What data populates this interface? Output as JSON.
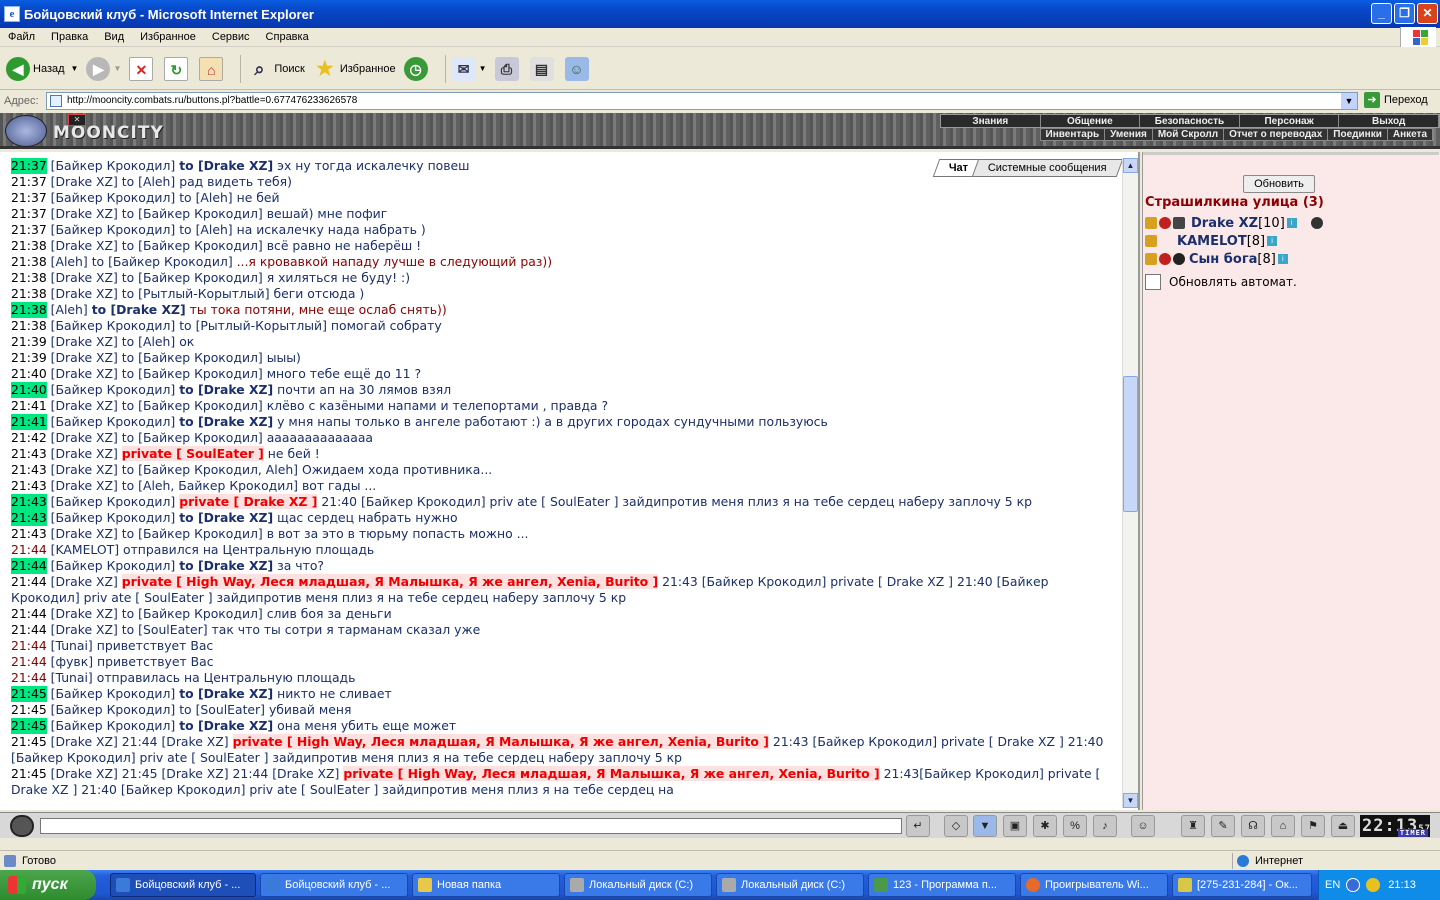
{
  "window": {
    "title": "Бойцовский клуб - Microsoft Internet Explorer"
  },
  "menu": [
    "Файл",
    "Правка",
    "Вид",
    "Избранное",
    "Сервис",
    "Справка"
  ],
  "toolbar": {
    "back": "Назад",
    "search": "Поиск",
    "favorites": "Избранное"
  },
  "address": {
    "label": "Адрес:",
    "url": "http://mooncity.combats.ru/buttons.pl?battle=0.677476233626578",
    "go": "Переход"
  },
  "game": {
    "logo": "MOONCITY",
    "nav": [
      "Знания",
      "Общение",
      "Безопасность",
      "Персонаж",
      "Выход"
    ],
    "subnav": [
      "Инвентарь",
      "Умения",
      "Мой Скролл",
      "Отчет о переводах",
      "Поединки",
      "Анкета"
    ]
  },
  "chat": {
    "tabs": [
      "Чат",
      "Системные сообщения"
    ],
    "messages": [
      {
        "time": "21:37",
        "hl": true,
        "nick": "[Байкер Крокодил]",
        "to": "to [Drake XZ]",
        "tobold": true,
        "text": "эх ну тогда искалечку повеш"
      },
      {
        "time": "21:37",
        "nick": "[Drake XZ]",
        "to": "to [Aleh]",
        "text": "рад видеть тебя)"
      },
      {
        "time": "21:37",
        "nick": "[Байкер Крокодил]",
        "to": "to [Aleh]",
        "text": "не бей"
      },
      {
        "time": "21:37",
        "nick": "[Drake XZ]",
        "to": "to [Байкер Крокодил]",
        "text": "вешай) мне пофиг"
      },
      {
        "time": "21:37",
        "nick": "[Байкер Крокодил]",
        "to": "to [Aleh]",
        "text": "на искалечку нада набрать )"
      },
      {
        "time": "21:38",
        "nick": "[Drake XZ]",
        "to": "to [Байкер Крокодил]",
        "text": "всё равно не наберёш !"
      },
      {
        "time": "21:38",
        "nick": "[Aleh]",
        "to": "to [Байкер Крокодил]",
        "text": "...я кровавкой нападу лучше в следующий раз))",
        "red": true
      },
      {
        "time": "21:38",
        "nick": "[Drake XZ]",
        "to": "to [Байкер Крокодил]",
        "text": "я хиляться не буду! :)"
      },
      {
        "time": "21:38",
        "nick": "[Drake XZ]",
        "to": "to [Рытлый-Корытлый]",
        "text": "беги отсюда )"
      },
      {
        "time": "21:38",
        "hl": true,
        "nick": "[Aleh]",
        "to": "to [Drake XZ]",
        "tobold": true,
        "text": "ты тока потяни, мне еще ослаб снять))",
        "red": true
      },
      {
        "time": "21:38",
        "nick": "[Байкер Крокодил]",
        "to": "to [Рытлый-Корытлый]",
        "text": "помогай собрату"
      },
      {
        "time": "21:39",
        "nick": "[Drake XZ]",
        "to": "to [Aleh]",
        "text": "ок"
      },
      {
        "time": "21:39",
        "nick": "[Drake XZ]",
        "to": "to [Байкер Крокодил]",
        "text": "ыыы)"
      },
      {
        "time": "21:40",
        "nick": "[Drake XZ]",
        "to": "to [Байкер Крокодил]",
        "text": "много тебе ещё до 11 ?"
      },
      {
        "time": "21:40",
        "hl": true,
        "nick": "[Байкер Крокодил]",
        "to": "to [Drake XZ]",
        "tobold": true,
        "text": "почти ап на 30 лямов взял"
      },
      {
        "time": "21:41",
        "nick": "[Drake XZ]",
        "to": "to [Байкер Крокодил]",
        "text": "клёво с казёными напами и телепортами , правда ?"
      },
      {
        "time": "21:41",
        "hl": true,
        "nick": "[Байкер Крокодил]",
        "to": "to [Drake XZ]",
        "tobold": true,
        "text": "у мня напы только в ангеле работают :) а в других городах сундучными пользуюсь"
      },
      {
        "time": "21:42",
        "nick": "[Drake XZ]",
        "to": "to [Байкер Крокодил]",
        "text": "аааааааааааааа"
      },
      {
        "time": "21:43",
        "nick": "[Drake XZ]",
        "priv": "private [ SoulEater ]",
        "text": "не бей !"
      },
      {
        "time": "21:43",
        "nick": "[Drake XZ]",
        "to": "to [Байкер Крокодил, Aleh]",
        "text": "Ожидаем хода противника..."
      },
      {
        "time": "21:43",
        "nick": "[Drake XZ]",
        "to": "to [Aleh, Байкер Крокодил]",
        "text": "вот гады ..."
      },
      {
        "time": "21:43",
        "hl": true,
        "nick": "[Байкер Крокодил]",
        "priv": "private [ Drake XZ ]",
        "text": "21:40 [Байкер Крокодил] priv ate [ SoulEater ] зайдипротив меня плиз я на тебе сердец наберу заплочу 5 кр"
      },
      {
        "time": "21:43",
        "hl": true,
        "nick": "[Байкер Крокодил]",
        "to": "to [Drake XZ]",
        "tobold": true,
        "text": "щас сердец набрать нужно"
      },
      {
        "time": "21:43",
        "nick": "[Drake XZ]",
        "to": "to [Байкер Крокодил]",
        "text": "в вот за это в тюрьму попасть можно ..."
      },
      {
        "time": "21:44",
        "sys": true,
        "nick": "[KAMELOT]",
        "text": "отправился на Центральную площадь"
      },
      {
        "time": "21:44",
        "hl": true,
        "nick": "[Байкер Крокодил]",
        "to": "to [Drake XZ]",
        "tobold": true,
        "text": "за что?"
      },
      {
        "time": "21:44",
        "nick": "[Drake XZ]",
        "priv": "private [ High Way, Леся младшая, Я Малышка, Я же ангел, Xenia, Burito ]",
        "text": "21:43 [Байкер Крокодил] private [ Drake XZ ] 21:40 [Байкер Крокодил] priv ate [ SoulEater ] зайдипротив меня плиз я на тебе сердец наберу заплочу 5 кр",
        "tall": true
      },
      {
        "time": "21:44",
        "nick": "[Drake XZ]",
        "to": "to [Байкер Крокодил]",
        "text": "слив боя за деньги"
      },
      {
        "time": "21:44",
        "nick": "[Drake XZ]",
        "to": "to [SoulEater]",
        "text": "так что ты сотри я тарманам сказал уже"
      },
      {
        "time": "21:44",
        "sys": true,
        "nick": "[Tunai]",
        "text": "приветствует Вас"
      },
      {
        "time": "21:44",
        "sys": true,
        "nick": "[фувк]",
        "text": "приветствует Вас"
      },
      {
        "time": "21:44",
        "sys": true,
        "nick": "[Tunai]",
        "text": "отправилась на Центральную площадь"
      },
      {
        "time": "21:45",
        "hl": true,
        "nick": "[Байкер Крокодил]",
        "to": "to [Drake XZ]",
        "tobold": true,
        "text": "никто не сливает"
      },
      {
        "time": "21:45",
        "nick": "[Байкер Крокодил]",
        "to": "to [SoulEater]",
        "text": "убивай меня"
      },
      {
        "time": "21:45",
        "hl": true,
        "nick": "[Байкер Крокодил]",
        "to": "to [Drake XZ]",
        "tobold": true,
        "text": "она меня убить еще может"
      },
      {
        "time": "21:45",
        "nick": "[Drake XZ]",
        "pre": "21:44 [Drake XZ]",
        "priv": "private [ High Way, Леся младшая, Я Малышка, Я же ангел, Xenia, Burito ]",
        "text": "21:43 [Байкер Крокодил] private [ Drake XZ ] 21:40 [Байкер Крокодил] priv ate [ SoulEater ] зайдипротив меня плиз я на тебе сердец наберу заплочу 5 кр",
        "tall": true
      },
      {
        "time": "21:45",
        "nick": "[Drake XZ]",
        "pre": "21:45 [Drake XZ] 21:44 [Drake XZ]",
        "priv": "private [ High Way, Леся младшая, Я Малышка, Я же ангел, Xenia, Burito ]",
        "text": "21:43[Байкер Крокодил] private [ Drake XZ ] 21:40 [Байкер Крокодил] priv ate [ SoulEater ] зайдипротив меня плиз я на тебе сердец на",
        "tall": true
      }
    ]
  },
  "room": {
    "refresh": "Обновить",
    "title": "Страшилкина улица (3)",
    "users": [
      {
        "name": "Drake XZ",
        "level": "[10]"
      },
      {
        "name": "KAMELOT",
        "level": "[8]"
      },
      {
        "name": "Сын бога",
        "level": "[8]"
      }
    ],
    "auto_refresh": "Обновлять автомат."
  },
  "timer": {
    "time": "22:13",
    "sec": "57",
    "label": "TIMER"
  },
  "status": {
    "left": "Готово",
    "zone": "Интернет"
  },
  "taskbar": {
    "start": "пуск",
    "tasks": [
      "Бойцовский клуб - ...",
      "Бойцовский клуб - ...",
      "Новая папка",
      "Локальный диск (C:)",
      "Локальный диск (C:)",
      "123 - Программа п...",
      "Проигрыватель Wi...",
      "[275-231-284] - Ок..."
    ],
    "lang": "EN",
    "clock": "21:13"
  }
}
